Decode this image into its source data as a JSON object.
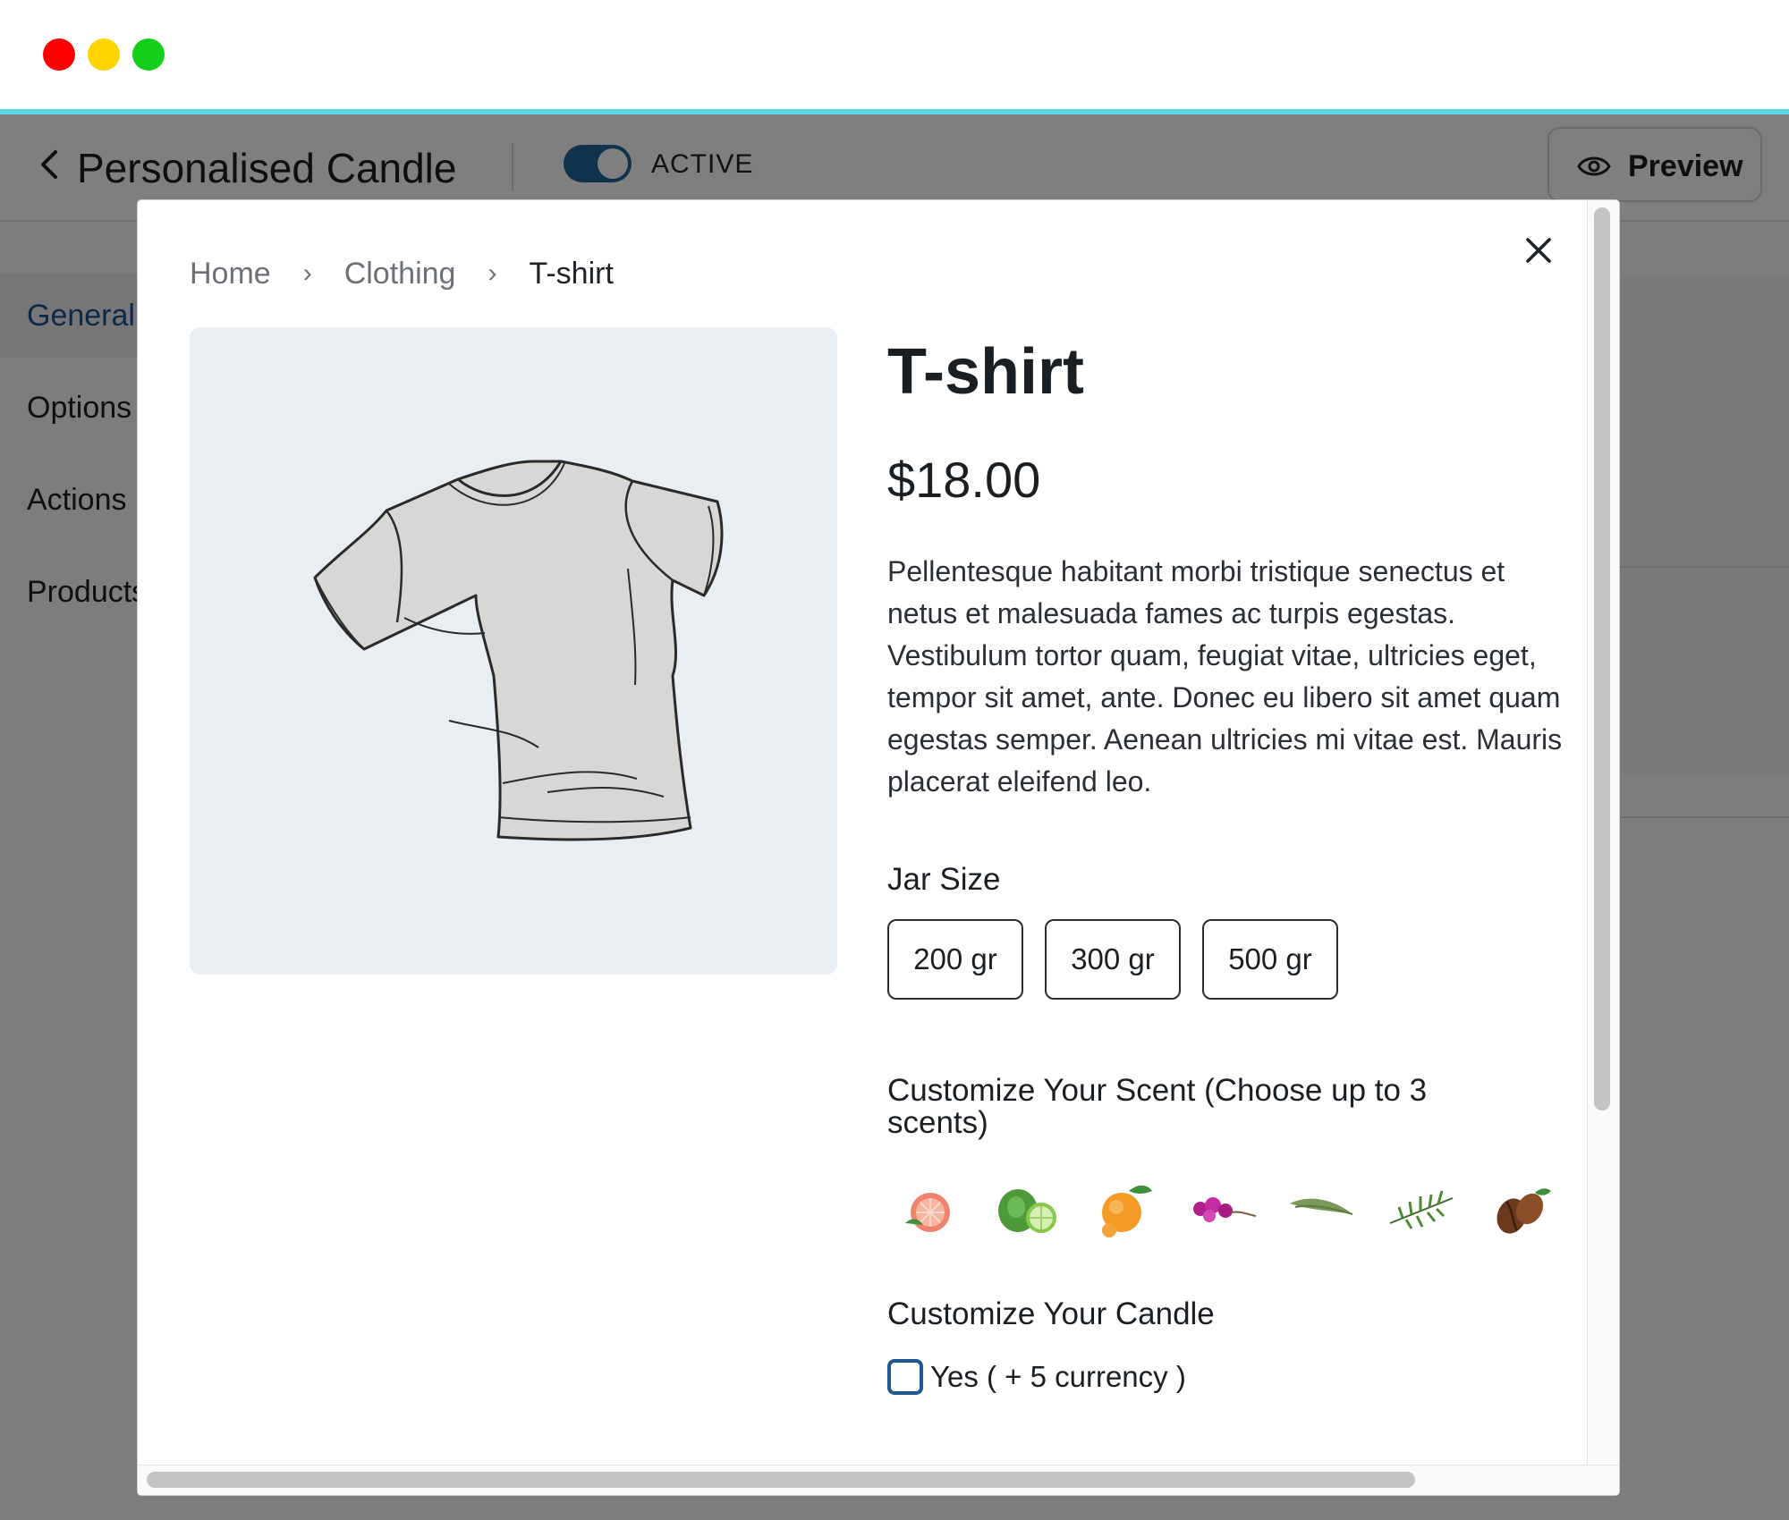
{
  "header": {
    "title": "Personalised Candle",
    "status": "ACTIVE",
    "preview_label": "Preview"
  },
  "sidebar": {
    "items": [
      {
        "label": "General",
        "active": true
      },
      {
        "label": "Options"
      },
      {
        "label": "Actions"
      },
      {
        "label": "Products"
      }
    ]
  },
  "modal": {
    "breadcrumb": [
      "Home",
      "Clothing",
      "T-shirt"
    ],
    "product_title": "T-shirt",
    "price": "$18.00",
    "description": "Pellentesque habitant morbi tristique senectus et netus et malesuada fames ac turpis egestas. Vestibulum tortor quam, feugiat vitae, ultricies eget, tempor sit amet, ante. Donec eu libero sit amet quam egestas semper. Aenean ultricies mi vitae est. Mauris placerat eleifend leo.",
    "jar_size": {
      "label": "Jar Size",
      "options": [
        "200 gr",
        "300 gr",
        "500 gr"
      ]
    },
    "scent": {
      "label": "Customize Your Scent (Choose up to 3 scents)",
      "options": [
        "grapefruit-icon",
        "bergamot-lime-icon",
        "mandarin-icon",
        "orchid-icon",
        "bamboo-leaf-icon",
        "rosemary-icon",
        "coffee-bean-icon"
      ]
    },
    "customize": {
      "label": "Customize Your Candle",
      "checkbox_label": "Yes ( + 5 currency )",
      "checked": false
    }
  },
  "colors": {
    "accent_line": "#5bd8de",
    "toggle_on": "#0f324d",
    "checkbox_border": "#1e5a8f"
  }
}
